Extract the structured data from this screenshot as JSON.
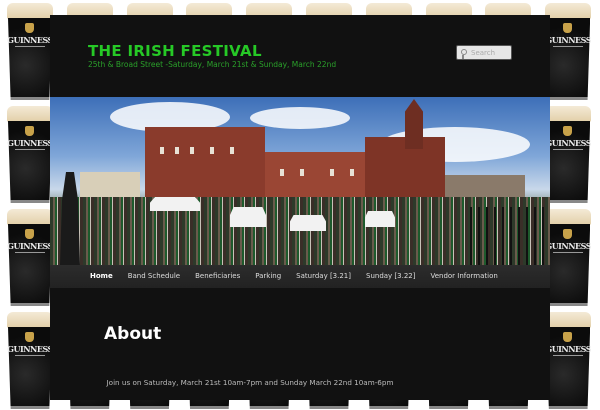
{
  "background": {
    "glass_brand": "GUINNESS",
    "glass_sub": "DRAUGHT"
  },
  "header": {
    "title": "THE IRISH FESTIVAL",
    "tagline": "25th & Broad Street -Saturday, March 21st & Sunday, March 22nd",
    "search_placeholder": "Search"
  },
  "nav": {
    "items": [
      {
        "label": "Home",
        "active": true
      },
      {
        "label": "Band Schedule"
      },
      {
        "label": "Beneficiaries"
      },
      {
        "label": "Parking"
      },
      {
        "label": "Saturday [3.21]"
      },
      {
        "label": "Sunday [3.22]"
      },
      {
        "label": "Vendor Information"
      }
    ]
  },
  "content": {
    "heading": "About",
    "intro": "Join us on Saturday, March 21st 10am-7pm and Sunday March 22nd 10am-6pm"
  },
  "colors": {
    "title": "#26c926",
    "page_bg": "#111111"
  }
}
